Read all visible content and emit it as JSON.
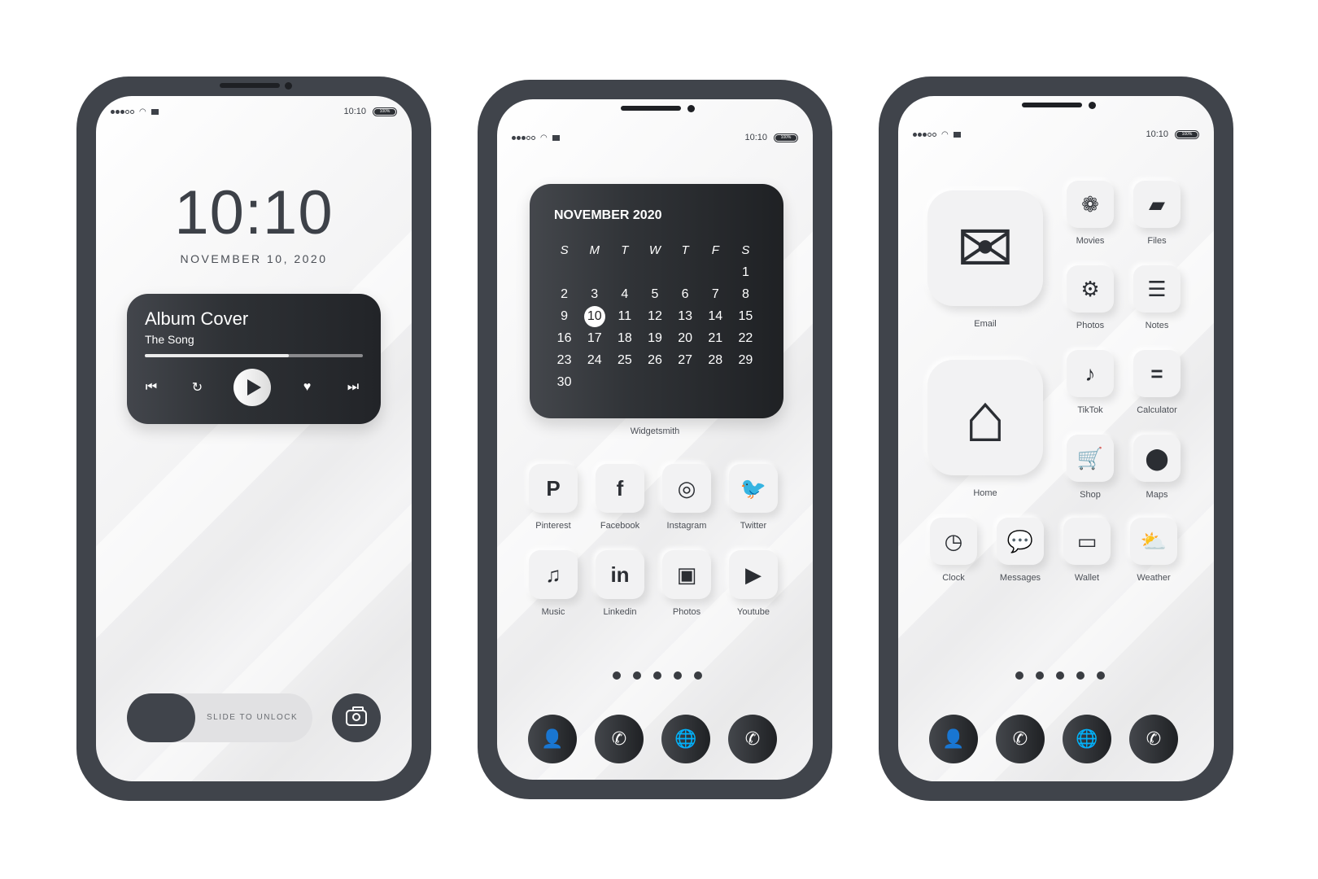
{
  "status_bar": {
    "time": "10:10",
    "battery": "100%",
    "signal_bars_filled": 3,
    "signal_bars_total": 5
  },
  "lock_screen": {
    "clock": "10:10",
    "date": "NOVEMBER 10, 2020",
    "music": {
      "title": "Album Cover",
      "song": "The Song",
      "progress_percent": 66,
      "controls": [
        "previous-icon",
        "repeat-icon",
        "play-icon",
        "heart-icon",
        "next-icon"
      ]
    },
    "slide_label": "SLIDE TO UNLOCK",
    "camera_icon": "camera-icon"
  },
  "home_screen_1": {
    "calendar": {
      "title": "NOVEMBER 2020",
      "weekdays": [
        "S",
        "M",
        "T",
        "W",
        "T",
        "F",
        "S"
      ],
      "days": [
        "",
        "",
        "",
        "",
        "",
        "",
        "1",
        "2",
        "3",
        "4",
        "5",
        "6",
        "7",
        "8",
        "9",
        "10",
        "11",
        "12",
        "13",
        "14",
        "15",
        "16",
        "17",
        "18",
        "19",
        "20",
        "21",
        "22",
        "23",
        "24",
        "25",
        "26",
        "27",
        "28",
        "29",
        "30"
      ],
      "today": "10"
    },
    "widget_label": "Widgetsmith",
    "apps": [
      {
        "label": "Pinterest",
        "icon": "pinterest-icon",
        "glyph": "P"
      },
      {
        "label": "Facebook",
        "icon": "facebook-icon",
        "glyph": "f"
      },
      {
        "label": "Instagram",
        "icon": "instagram-icon",
        "glyph": "◎"
      },
      {
        "label": "Twitter",
        "icon": "twitter-icon",
        "glyph": "🐦"
      },
      {
        "label": "Music",
        "icon": "music-icon",
        "glyph": "♫"
      },
      {
        "label": "Linkedin",
        "icon": "linkedin-icon",
        "glyph": "in"
      },
      {
        "label": "Photos",
        "icon": "photos-icon",
        "glyph": "▣"
      },
      {
        "label": "Youtube",
        "icon": "youtube-icon",
        "glyph": "▶"
      }
    ],
    "page_dots": 5,
    "dock": [
      {
        "icon": "contacts-icon",
        "glyph": "👤"
      },
      {
        "icon": "whatsapp-icon",
        "glyph": "✆"
      },
      {
        "icon": "browser-globe-icon",
        "glyph": "🌐"
      },
      {
        "icon": "phone-icon",
        "glyph": "✆"
      }
    ]
  },
  "home_screen_2": {
    "large_apps": [
      {
        "label": "Email",
        "icon": "mail-icon",
        "glyph": "✉"
      },
      {
        "label": "Home",
        "icon": "home-icon",
        "glyph": "⌂"
      }
    ],
    "apps": [
      {
        "label": "Movies",
        "icon": "film-reel-icon",
        "glyph": "❁"
      },
      {
        "label": "Files",
        "icon": "folder-icon",
        "glyph": "▰"
      },
      {
        "label": "Photos",
        "icon": "gear-icon",
        "glyph": "⚙"
      },
      {
        "label": "Notes",
        "icon": "notepad-icon",
        "glyph": "☰"
      },
      {
        "label": "TikTok",
        "icon": "tiktok-icon",
        "glyph": "♪"
      },
      {
        "label": "Calculator",
        "icon": "calculator-icon",
        "glyph": "="
      },
      {
        "label": "Shop",
        "icon": "cart-icon",
        "glyph": "🛒"
      },
      {
        "label": "Maps",
        "icon": "map-pin-icon",
        "glyph": "⬤"
      },
      {
        "label": "Clock",
        "icon": "clock-icon",
        "glyph": "◷"
      },
      {
        "label": "Messages",
        "icon": "chat-bubble-icon",
        "glyph": "💬"
      },
      {
        "label": "Wallet",
        "icon": "wallet-icon",
        "glyph": "▭"
      },
      {
        "label": "Weather",
        "icon": "weather-icon",
        "glyph": "⛅"
      }
    ],
    "page_dots": 5,
    "dock": [
      {
        "icon": "contacts-icon",
        "glyph": "👤"
      },
      {
        "icon": "whatsapp-icon",
        "glyph": "✆"
      },
      {
        "icon": "browser-globe-icon",
        "glyph": "🌐"
      },
      {
        "icon": "phone-icon",
        "glyph": "✆"
      }
    ]
  }
}
